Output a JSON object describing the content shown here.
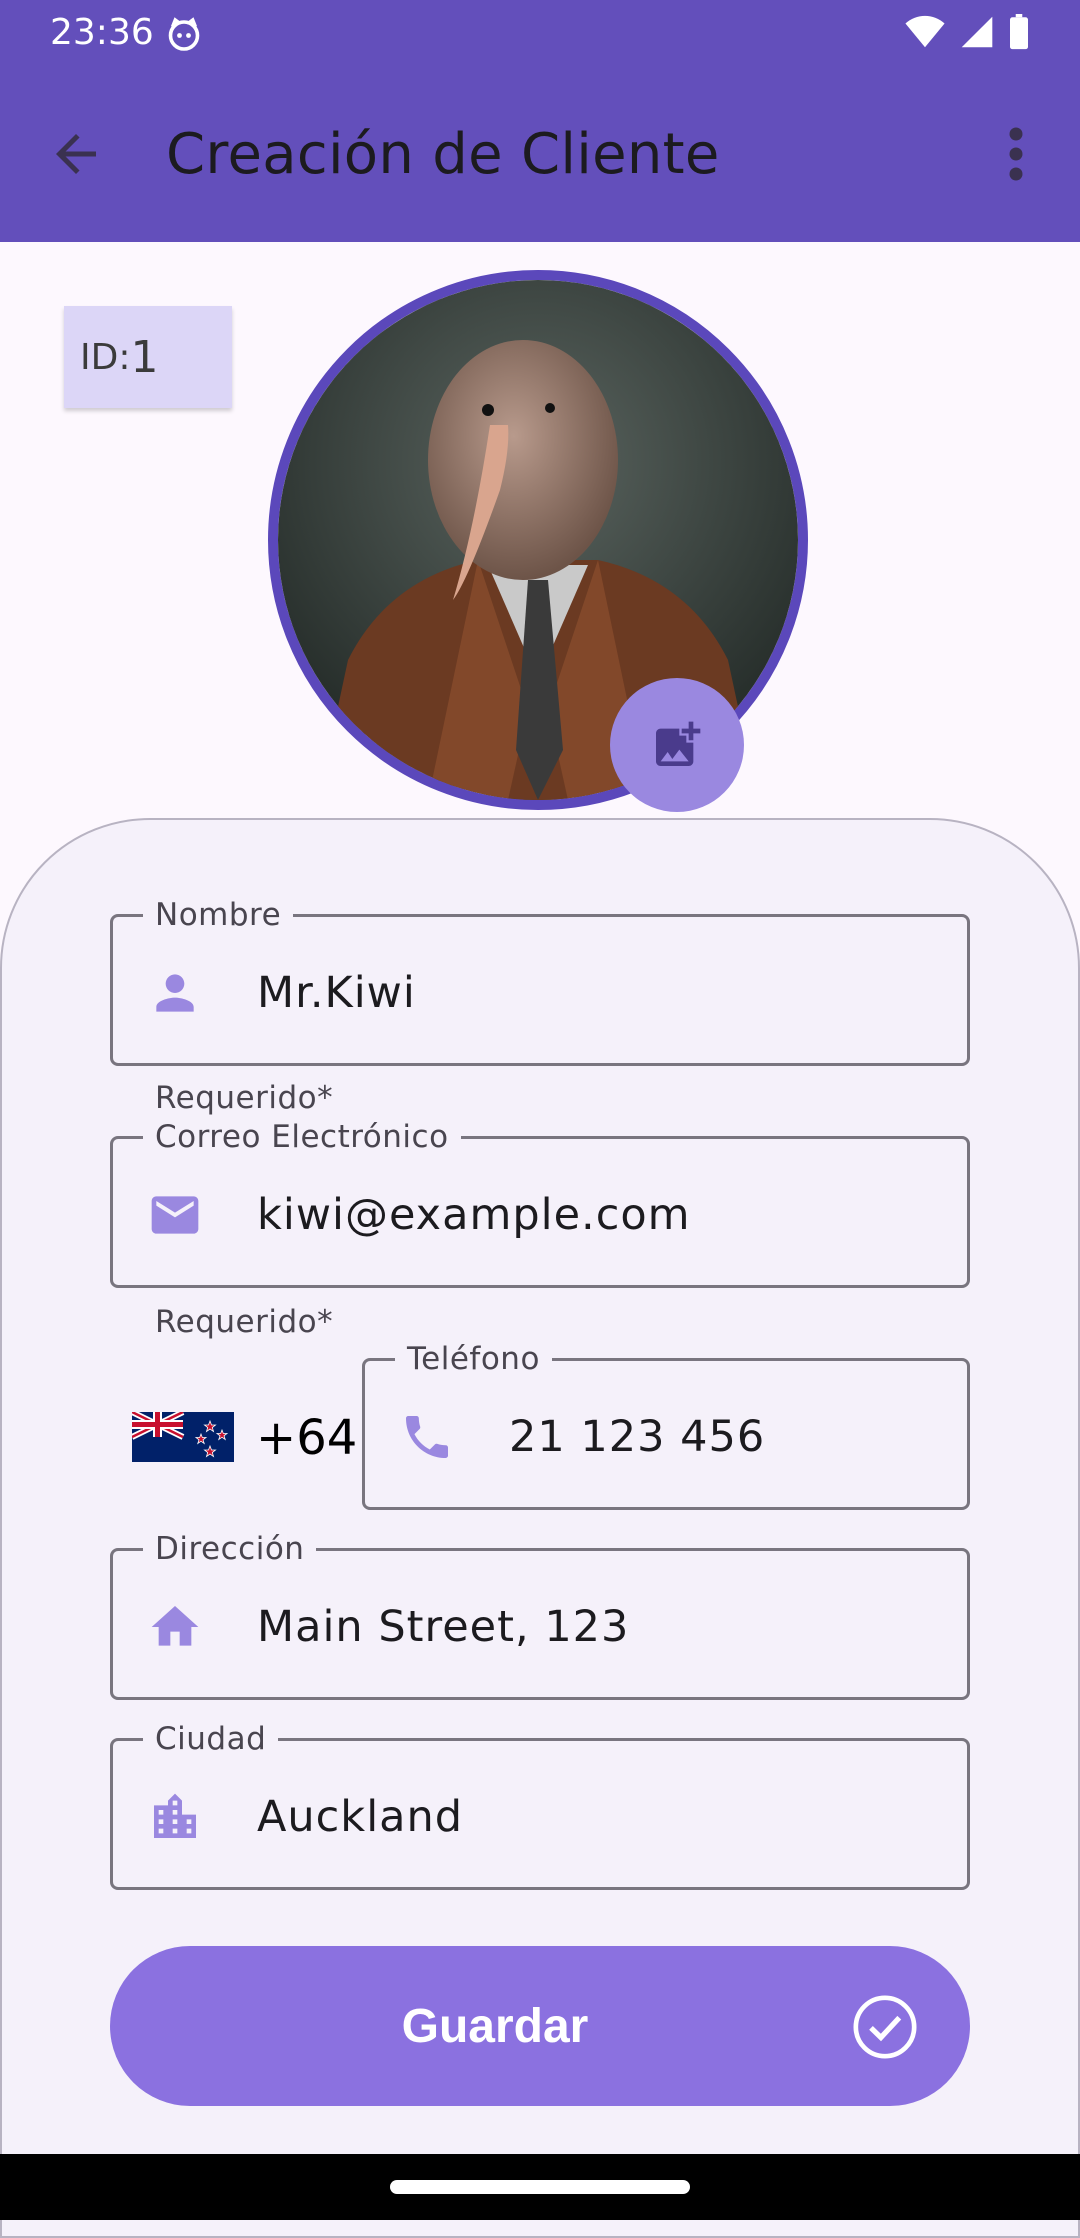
{
  "status_bar": {
    "time": "23:36"
  },
  "app_bar": {
    "title": "Creación de Cliente"
  },
  "client": {
    "id_label": "ID:",
    "id_value": "1"
  },
  "form": {
    "name": {
      "label": "Nombre",
      "value": "Mr.Kiwi",
      "helper": "Requerido*"
    },
    "email": {
      "label": "Correo Electrónico",
      "value": "kiwi@example.com",
      "helper": "Requerido*"
    },
    "phone": {
      "label": "Teléfono",
      "country_code": "+64",
      "value": "21 123 456",
      "country_flag": "new-zealand-flag"
    },
    "address": {
      "label": "Dirección",
      "value": "Main Street, 123"
    },
    "city": {
      "label": "Ciudad",
      "value": "Auckland"
    }
  },
  "save_button": {
    "label": "Guardar"
  },
  "colors": {
    "app_bar": "#634fbb",
    "accent": "#8b71e0",
    "icon": "#9a88e0",
    "card_background": "#f5f1fa"
  }
}
